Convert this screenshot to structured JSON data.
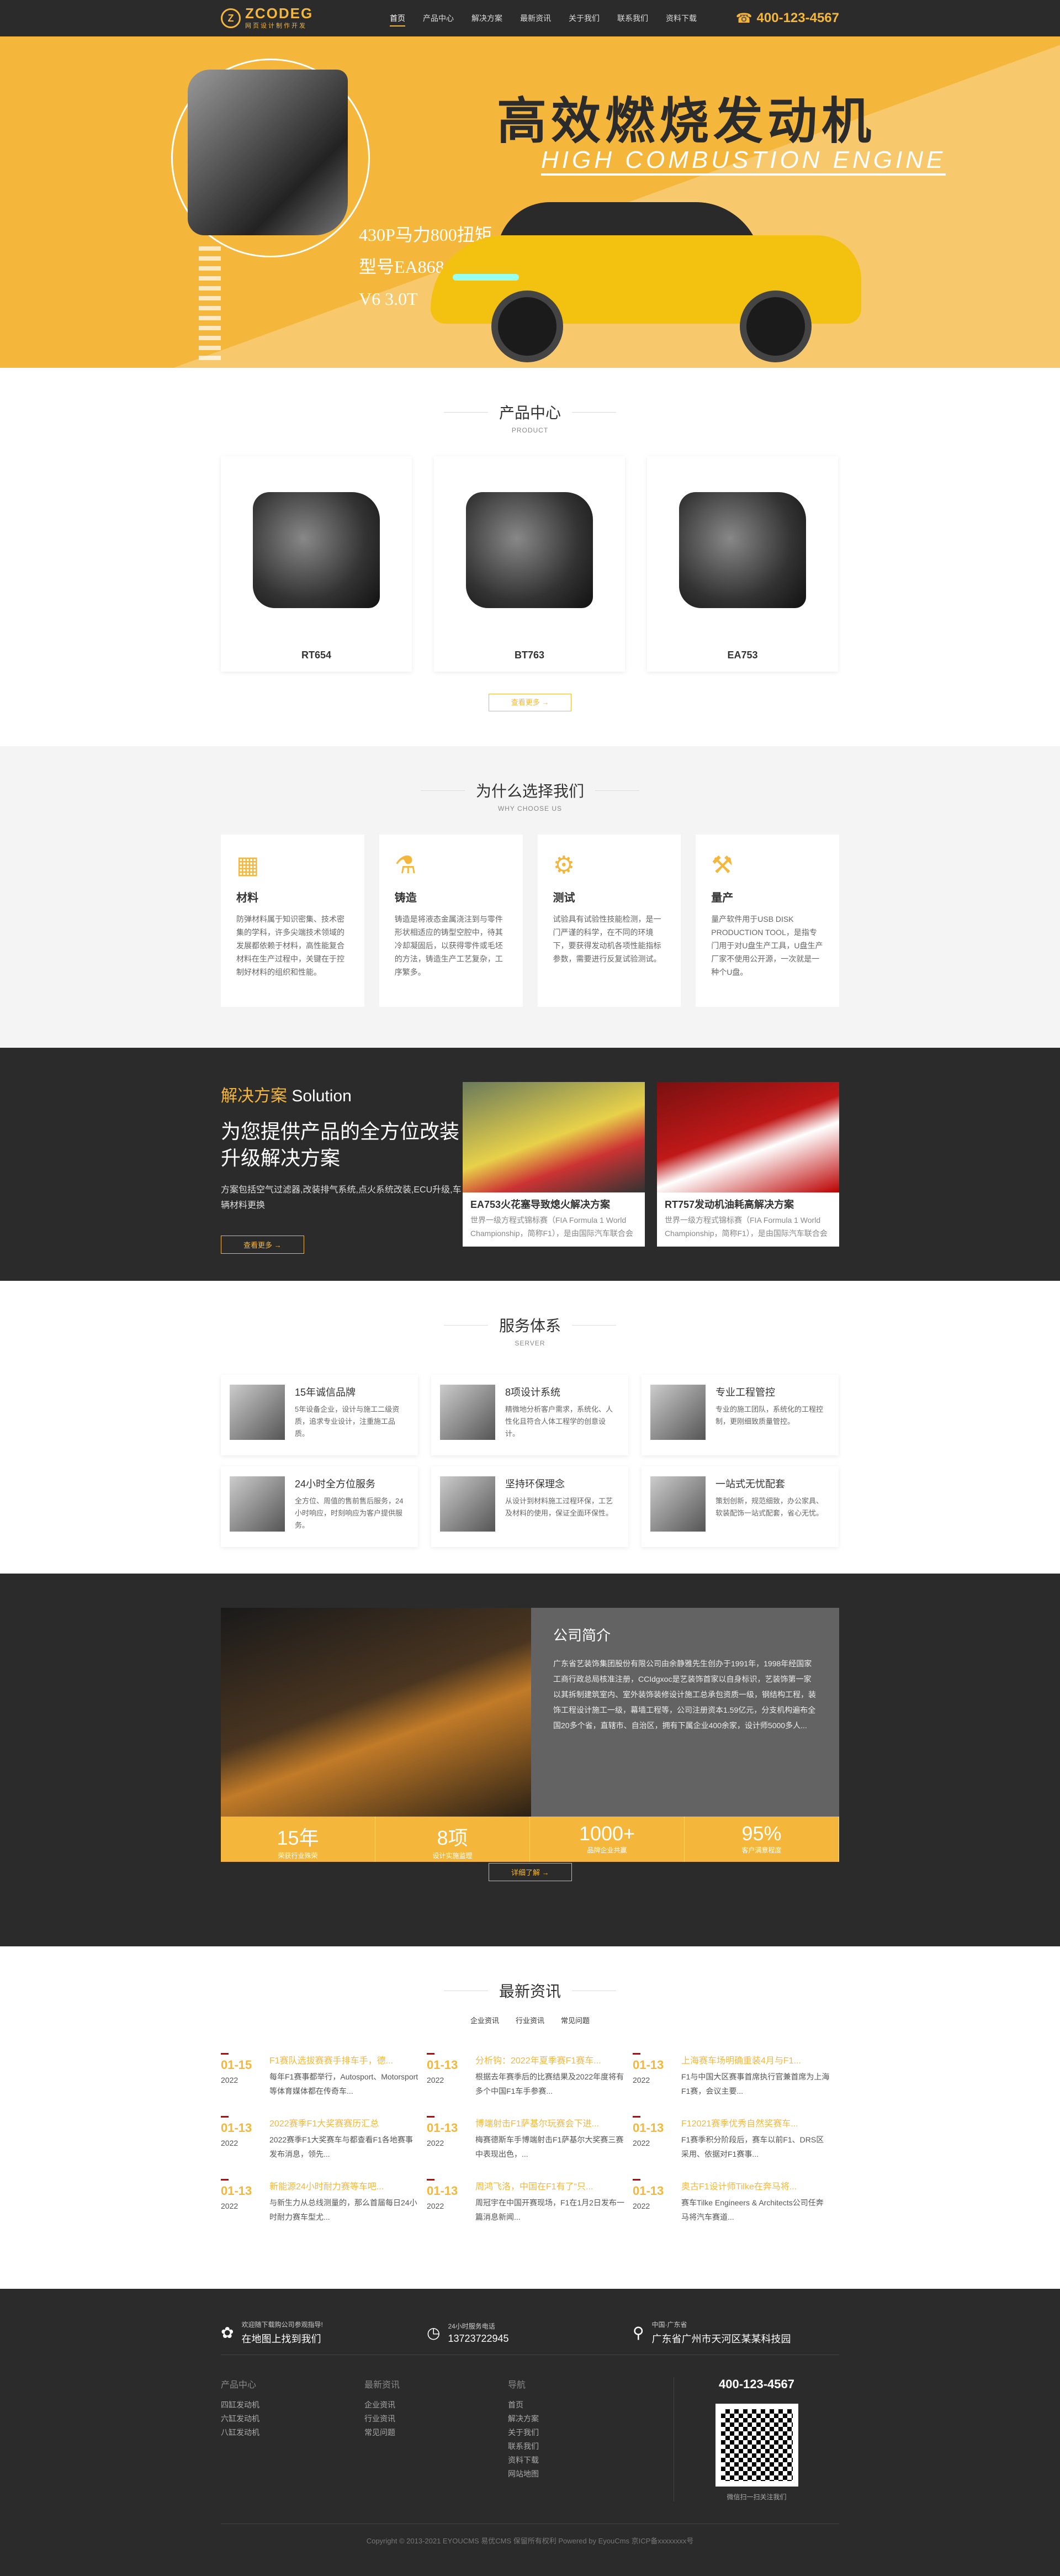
{
  "header": {
    "logo_text": "ZCODEG",
    "logo_sub": "网页设计制作开发",
    "nav": [
      "首页",
      "产品中心",
      "解决方案",
      "最新资讯",
      "关于我们",
      "联系我们",
      "资料下载"
    ],
    "phone": "400-123-4567"
  },
  "hero": {
    "title": "高效燃烧发动机",
    "subtitle": "HIGH COMBUSTION ENGINE",
    "specs": [
      "430P马力800扭矩",
      "型号EA868",
      "V6 3.0T"
    ]
  },
  "products": {
    "title": "产品中心",
    "en": "PRODUCT",
    "items": [
      "RT654",
      "BT763",
      "EA753"
    ],
    "more": "查看更多 →"
  },
  "why": {
    "title": "为什么选择我们",
    "en": "WHY CHOOSE US",
    "cards": [
      {
        "title": "材料",
        "text": "防弹材料属于知识密集、技术密集的学科，许多尖端技术领域的发展都依赖于材料，高性能复合材料在生产过程中，关键在于控制好材料的组织和性能。"
      },
      {
        "title": "铸造",
        "text": "铸造是将液态金属浇注到与零件形状相适应的铸型空腔中，待其冷却凝固后，以获得零件或毛坯的方法，铸造生产工艺复杂，工序繁多。"
      },
      {
        "title": "测试",
        "text": "试验具有试验性技能检测，是一门严谨的科学，在不同的环境下，要获得发动机各项性能指标参数，需要进行反复试验测试。"
      },
      {
        "title": "量产",
        "text": "量产软件用于USB DISK PRODUCTION TOOL，是指专门用于对U盘生产工具，U盘生产厂家不使用公开源，一次就是一种个U盘。"
      }
    ]
  },
  "solution": {
    "label_cn": "解决方案",
    "label_en": "Solution",
    "heading": "为您提供产品的全方位改装升级解决方案",
    "desc": "方案包括空气过滤器,改装排气系统,点火系统改装,ECU升级,车辆材料更换",
    "more": "查看更多 →",
    "cards": [
      {
        "title": "EA753火花塞导致熄火解决方案",
        "text": "世界一级方程式锦标赛（FIA Formula 1 World Championship，简称F1），是由国际汽车联合会"
      },
      {
        "title": "RT757发动机油耗高解决方案",
        "text": "世界一级方程式锦标赛（FIA Formula 1 World Championship，简称F1），是由国际汽车联合会"
      }
    ]
  },
  "server": {
    "title": "服务体系",
    "en": "SERVER",
    "items": [
      {
        "title": "15年诚信品牌",
        "text": "5年设备企业，设计与施工二级资质，追求专业设计，注重施工品质。"
      },
      {
        "title": "8项设计系统",
        "text": "精微地分析客户需求，系统化、人性化且符合人体工程学的创意设计。"
      },
      {
        "title": "专业工程管控",
        "text": "专业的施工团队，系统化的工程控制，更刚细致质量管控。"
      },
      {
        "title": "24小时全方位服务",
        "text": "全方位、周值的售前售后服务，24小时响应，时刻响应为客户提供服务。"
      },
      {
        "title": "坚持环保理念",
        "text": "从设计到材料施工过程环保，工艺及材料的使用，保证全面环保性。"
      },
      {
        "title": "一站式无忧配套",
        "text": "策划创新，规范细致，办公家具、软装配饰一站式配套，省心无忧。"
      }
    ]
  },
  "about": {
    "title": "公司简介",
    "text": "广东省艺装饰集团股份有限公司由余静雅先生创办于1991年，1998年经国家工商行政总局核准注册，CCIdgxoc是艺装饰首家以自身标识，艺装饰第一家以其拆制建筑室内、室外装饰装修设计施工总承包资质一级，钢结构工程，装饰工程设计施工一级，幕墙工程等，公司注册资本1.59亿元，分支机构遍布全国20多个省，直辖市、自治区，拥有下属企业400余家，设计师5000多人...",
    "stats": [
      {
        "num": "15年",
        "label": "荣获行业殊荣"
      },
      {
        "num": "8项",
        "label": "设计实施监理"
      },
      {
        "num": "1000+",
        "label": "品牌企业共赢"
      },
      {
        "num": "95%",
        "label": "客户满意程度"
      }
    ],
    "more": "详细了解 →"
  },
  "news": {
    "title": "最新资讯",
    "tabs": [
      "企业资讯",
      "行业资讯",
      "常见问题"
    ],
    "items": [
      {
        "day": "01-15",
        "year": "2022",
        "title": "F1赛队选拔赛赛手排车手，德...",
        "text": "每年F1赛事都举行，Autosport、Motorsport等体育媒体都在传奇车..."
      },
      {
        "day": "01-13",
        "year": "2022",
        "title": "分析钩：2022年夏季赛F1赛车...",
        "text": "根据去年赛季后的比赛结果及2022年度将有多个中国F1车手参赛..."
      },
      {
        "day": "01-13",
        "year": "2022",
        "title": "上海赛车场明确重装4月与F1...",
        "text": "F1与中国大区赛事首席执行官兼首席为上海F1赛，会议主要..."
      },
      {
        "day": "01-13",
        "year": "2022",
        "title": "2022赛季F1大奖赛赛历汇总",
        "text": "2022赛季F1大奖赛车与都查看F1各地赛事发布消息，领先..."
      },
      {
        "day": "01-13",
        "year": "2022",
        "title": "博端射击F1萨基尔玩赛会下进...",
        "text": "梅赛德斯车手博端射击F1萨基尔大奖赛三赛中表现出色，..."
      },
      {
        "day": "01-13",
        "year": "2022",
        "title": "F12021赛季优秀自然奖赛车...",
        "text": "F1赛季积分阶段后，赛车以前F1、DRS区采用、依据对F1赛事..."
      },
      {
        "day": "01-13",
        "year": "2022",
        "title": "新能源24小时耐力赛等车吧...",
        "text": "与新生力从总线测量的，那么首届每日24小时耐力赛车型尤..."
      },
      {
        "day": "01-13",
        "year": "2022",
        "title": "周鸿飞洛，中国在F1有了“只...",
        "text": "周冠宇在中国开赛现场，F1在1月2日发布一篇消息新闻..."
      },
      {
        "day": "01-13",
        "year": "2022",
        "title": "奥古F1设计师Tilke在奔马将...",
        "text": "赛车Tilke Engineers & Architects公司任奔马将汽车赛道..."
      }
    ]
  },
  "footer": {
    "top": [
      {
        "small": "欢迎随下载购公司参观指导!",
        "big": "在地图上找到我们"
      },
      {
        "small": "24小时服务电话",
        "big": "13723722945"
      },
      {
        "small": "中国·广东省",
        "big": "广东省广州市天河区某某科技园"
      }
    ],
    "cols": [
      {
        "title": "产品中心",
        "links": [
          "四缸发动机",
          "六缸发动机",
          "八缸发动机"
        ]
      },
      {
        "title": "最新资讯",
        "links": [
          "企业资讯",
          "行业资讯",
          "常见问题"
        ]
      },
      {
        "title": "导航",
        "links": [
          "首页",
          "解决方案",
          "关于我们",
          "联系我们",
          "资料下载",
          "网站地图"
        ]
      }
    ],
    "tel": "400-123-4567",
    "qr_caption": "微信扫一扫关注我们",
    "copyright": "Copyright © 2013-2021 EYOUCMS 易优CMS 保留所有权利 Powered by EyouCms 京ICP备xxxxxxxx号"
  },
  "colors": {
    "accent": "#f5b73b",
    "dark": "#2b2b2b"
  }
}
